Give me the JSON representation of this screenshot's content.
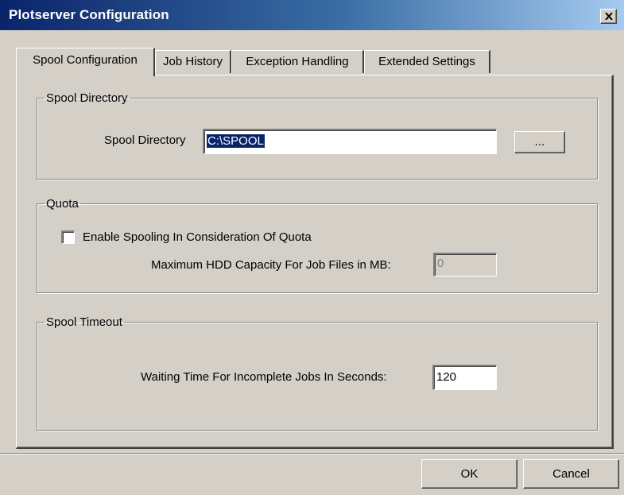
{
  "window": {
    "title": "Plotserver Configuration",
    "close_icon": "close-icon"
  },
  "tabs": [
    {
      "label": "Spool Configuration",
      "active": true
    },
    {
      "label": "Job History",
      "active": false
    },
    {
      "label": "Exception Handling",
      "active": false
    },
    {
      "label": "Extended Settings",
      "active": false
    }
  ],
  "spool_directory_group": {
    "title": "Spool Directory",
    "field_label": "Spool Directory",
    "value": "C:\\SPOOL",
    "browse_label": "..."
  },
  "quota_group": {
    "title": "Quota",
    "checkbox_label": "Enable Spooling In Consideration Of Quota",
    "checkbox_checked": false,
    "capacity_label": "Maximum HDD Capacity For Job Files in MB:",
    "capacity_value": "0",
    "capacity_disabled": true
  },
  "spool_timeout_group": {
    "title": "Spool Timeout",
    "waiting_label": "Waiting Time For Incomplete Jobs In Seconds:",
    "waiting_value": "120"
  },
  "footer": {
    "ok_label": "OK",
    "cancel_label": "Cancel"
  },
  "colors": {
    "titlebar_start": "#0a246a",
    "titlebar_end": "#a6caf0",
    "dialog_face": "#d4d0c8",
    "selection": "#0a246a"
  }
}
